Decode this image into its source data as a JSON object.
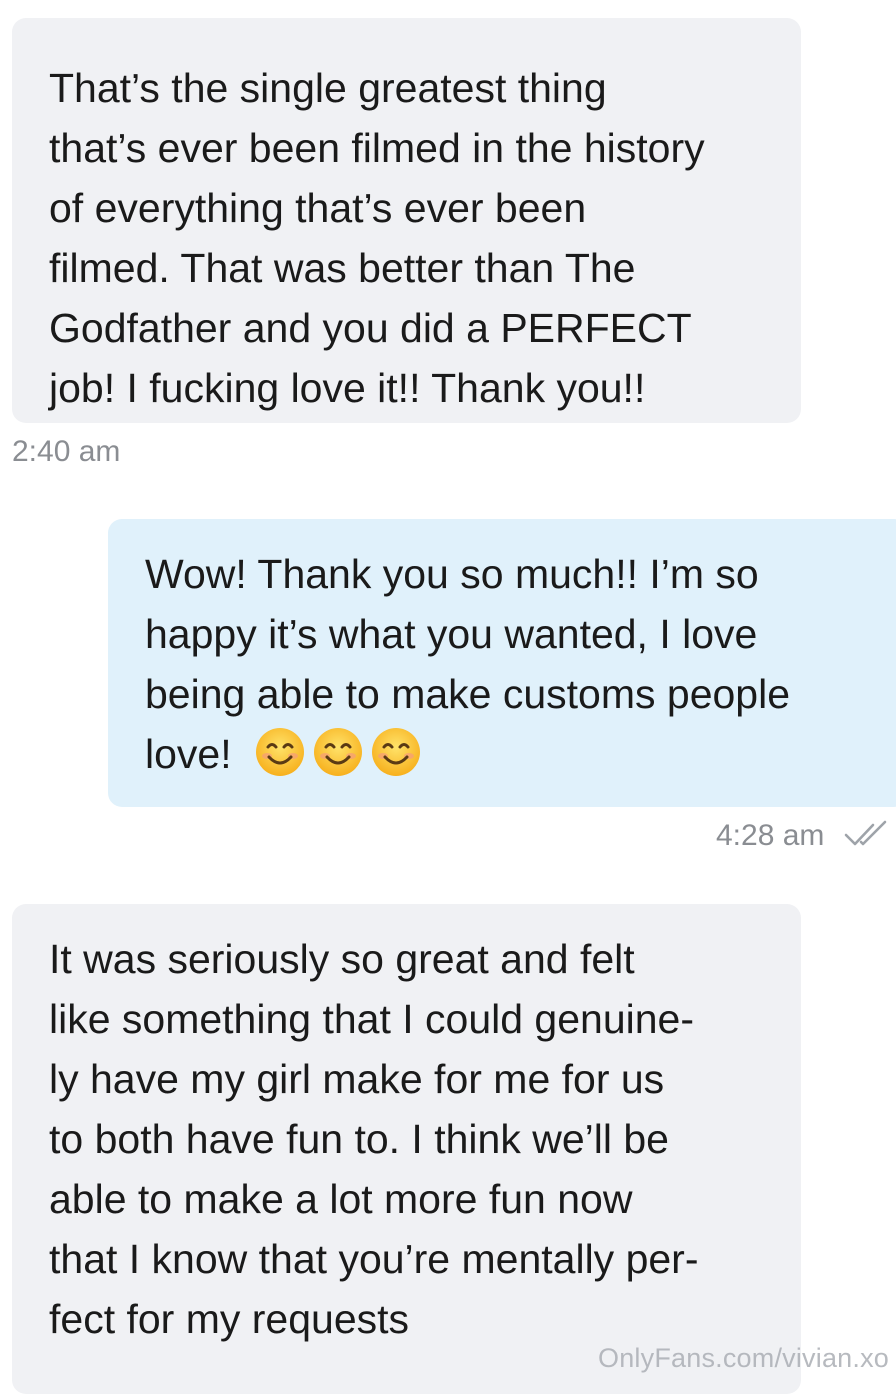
{
  "messages": [
    {
      "direction": "incoming",
      "lines": [
        "That’s the single greatest thing",
        "that’s ever been filmed in the history",
        "of everything that’s ever been",
        "filmed. That was better than The",
        "Godfather and you did a PERFECT",
        "job! I fucking love it!! Thank you!!"
      ],
      "time": "2:40 am"
    },
    {
      "direction": "outgoing",
      "lines": [
        "Wow! Thank you so much!! I’m so",
        "happy it’s what you wanted, I love",
        "being able to make customs people",
        "love!"
      ],
      "emojis": [
        "smiling-face-icon",
        "smiling-face-icon",
        "smiling-face-icon"
      ],
      "time": "4:28 am",
      "status_icon": "double-check-icon"
    },
    {
      "direction": "incoming",
      "lines": [
        "It was seriously so great and felt",
        "like something that I could genuine-",
        "ly have my girl make for me for us",
        "to both have fun to. I think we’ll be",
        "able to make a lot more fun now",
        "that I know that you’re mentally per-",
        "fect for my requests"
      ]
    }
  ],
  "watermark": "OnlyFans.com/vivian.xo",
  "colors": {
    "incoming_bubble": "#f0f1f4",
    "outgoing_bubble": "#e0f1fb",
    "timestamp_text": "#8a8d92",
    "read_check": "#9ea3a9"
  }
}
